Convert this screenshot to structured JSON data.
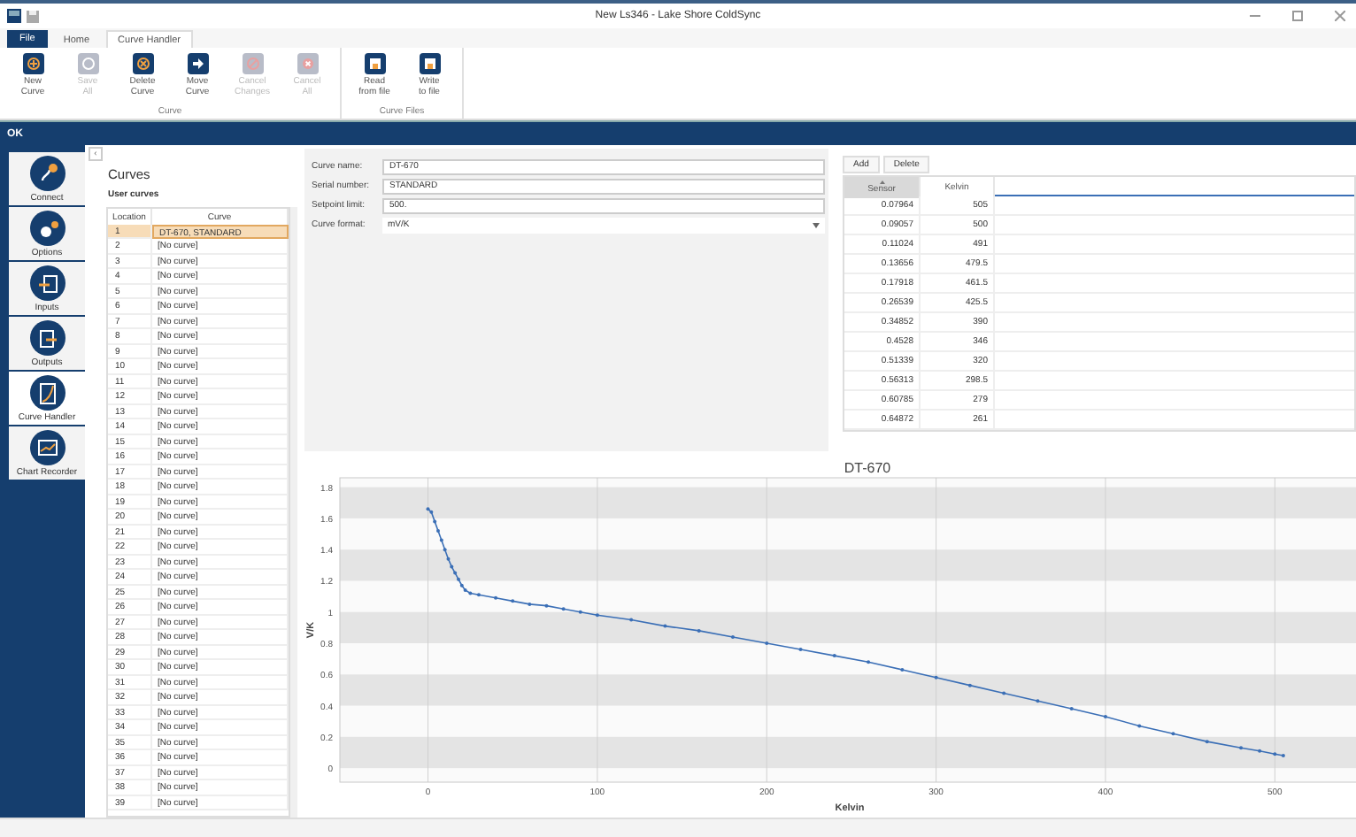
{
  "window": {
    "title": "New Ls346 - Lake Shore ColdSync"
  },
  "file_menu": {
    "label": "File"
  },
  "tabs": [
    {
      "label": "Home",
      "selected": false
    },
    {
      "label": "Curve Handler",
      "selected": true
    }
  ],
  "ribbon": {
    "groups": [
      {
        "label": "Curve",
        "buttons": [
          {
            "lines": [
              "New",
              "Curve"
            ],
            "disabled": false
          },
          {
            "lines": [
              "Save",
              "All"
            ],
            "disabled": true
          },
          {
            "lines": [
              "Delete",
              "Curve"
            ],
            "disabled": false
          },
          {
            "lines": [
              "Move",
              "Curve"
            ],
            "disabled": false
          },
          {
            "lines": [
              "Cancel",
              "Changes"
            ],
            "disabled": true
          },
          {
            "lines": [
              "Cancel",
              "All"
            ],
            "disabled": true
          }
        ]
      },
      {
        "label": "Curve Files",
        "buttons": [
          {
            "lines": [
              "Read",
              "from file"
            ],
            "disabled": false
          },
          {
            "lines": [
              "Write",
              "to file"
            ],
            "disabled": false
          }
        ]
      }
    ]
  },
  "status_strip": {
    "text": "OK"
  },
  "sidebar": {
    "items": [
      {
        "label": "Connect",
        "selected": false
      },
      {
        "label": "Options",
        "selected": false
      },
      {
        "label": "Inputs",
        "selected": false
      },
      {
        "label": "Outputs",
        "selected": false
      },
      {
        "label": "Curve Handler",
        "selected": true
      },
      {
        "label": "Chart Recorder",
        "selected": false
      }
    ]
  },
  "curves_panel": {
    "collapse": "‹",
    "title": "Curves",
    "subtitle": "User curves",
    "columns": [
      "Location",
      "Curve"
    ],
    "rows": [
      {
        "location": "1",
        "curve": "DT-670, STANDARD",
        "selected": true
      },
      {
        "location": "2",
        "curve": "[No curve]",
        "selected": false
      },
      {
        "location": "3",
        "curve": "[No curve]",
        "selected": false
      },
      {
        "location": "4",
        "curve": "[No curve]",
        "selected": false
      },
      {
        "location": "5",
        "curve": "[No curve]",
        "selected": false
      },
      {
        "location": "6",
        "curve": "[No curve]",
        "selected": false
      },
      {
        "location": "7",
        "curve": "[No curve]",
        "selected": false
      },
      {
        "location": "8",
        "curve": "[No curve]",
        "selected": false
      },
      {
        "location": "9",
        "curve": "[No curve]",
        "selected": false
      },
      {
        "location": "10",
        "curve": "[No curve]",
        "selected": false
      },
      {
        "location": "11",
        "curve": "[No curve]",
        "selected": false
      },
      {
        "location": "12",
        "curve": "[No curve]",
        "selected": false
      },
      {
        "location": "13",
        "curve": "[No curve]",
        "selected": false
      },
      {
        "location": "14",
        "curve": "[No curve]",
        "selected": false
      },
      {
        "location": "15",
        "curve": "[No curve]",
        "selected": false
      },
      {
        "location": "16",
        "curve": "[No curve]",
        "selected": false
      },
      {
        "location": "17",
        "curve": "[No curve]",
        "selected": false
      },
      {
        "location": "18",
        "curve": "[No curve]",
        "selected": false
      },
      {
        "location": "19",
        "curve": "[No curve]",
        "selected": false
      },
      {
        "location": "20",
        "curve": "[No curve]",
        "selected": false
      },
      {
        "location": "21",
        "curve": "[No curve]",
        "selected": false
      },
      {
        "location": "22",
        "curve": "[No curve]",
        "selected": false
      },
      {
        "location": "23",
        "curve": "[No curve]",
        "selected": false
      },
      {
        "location": "24",
        "curve": "[No curve]",
        "selected": false
      },
      {
        "location": "25",
        "curve": "[No curve]",
        "selected": false
      },
      {
        "location": "26",
        "curve": "[No curve]",
        "selected": false
      },
      {
        "location": "27",
        "curve": "[No curve]",
        "selected": false
      },
      {
        "location": "28",
        "curve": "[No curve]",
        "selected": false
      },
      {
        "location": "29",
        "curve": "[No curve]",
        "selected": false
      },
      {
        "location": "30",
        "curve": "[No curve]",
        "selected": false
      },
      {
        "location": "31",
        "curve": "[No curve]",
        "selected": false
      },
      {
        "location": "32",
        "curve": "[No curve]",
        "selected": false
      },
      {
        "location": "33",
        "curve": "[No curve]",
        "selected": false
      },
      {
        "location": "34",
        "curve": "[No curve]",
        "selected": false
      },
      {
        "location": "35",
        "curve": "[No curve]",
        "selected": false
      },
      {
        "location": "36",
        "curve": "[No curve]",
        "selected": false
      },
      {
        "location": "37",
        "curve": "[No curve]",
        "selected": false
      },
      {
        "location": "38",
        "curve": "[No curve]",
        "selected": false
      },
      {
        "location": "39",
        "curve": "[No curve]",
        "selected": false
      }
    ]
  },
  "form": {
    "fields": [
      {
        "label": "Curve name:",
        "value": "DT-670",
        "kind": "text"
      },
      {
        "label": "Serial number:",
        "value": "STANDARD",
        "kind": "text"
      },
      {
        "label": "Setpoint limit:",
        "value": "500.",
        "kind": "text"
      },
      {
        "label": "Curve format:",
        "value": "mV/K",
        "kind": "select"
      }
    ]
  },
  "points_table": {
    "buttons": [
      "Add",
      "Delete"
    ],
    "columns": [
      {
        "label": "Sensor",
        "sorted": true
      },
      {
        "label": "Kelvin",
        "sorted": false
      }
    ],
    "rows": [
      [
        "0.07964",
        "505"
      ],
      [
        "0.09057",
        "500"
      ],
      [
        "0.11024",
        "491"
      ],
      [
        "0.13656",
        "479.5"
      ],
      [
        "0.17918",
        "461.5"
      ],
      [
        "0.26539",
        "425.5"
      ],
      [
        "0.34852",
        "390"
      ],
      [
        "0.4528",
        "346"
      ],
      [
        "0.51339",
        "320"
      ],
      [
        "0.56313",
        "298.5"
      ],
      [
        "0.60785",
        "279"
      ],
      [
        "0.64872",
        "261"
      ]
    ]
  },
  "chart": {
    "chart_data": {
      "type": "line",
      "title": "DT-670",
      "xlabel": "Kelvin",
      "ylabel": "V/K",
      "x": [
        0,
        2,
        4,
        6,
        8,
        10,
        12,
        14,
        16,
        18,
        20,
        22,
        25,
        30,
        40,
        50,
        60,
        70,
        80,
        90,
        100,
        120,
        140,
        160,
        180,
        200,
        220,
        240,
        260,
        280,
        300,
        320,
        340,
        360,
        380,
        400,
        420,
        440,
        460,
        480,
        491,
        500,
        505
      ],
      "series": [
        {
          "color": "#3b6fb6",
          "values": [
            1.66,
            1.64,
            1.58,
            1.52,
            1.46,
            1.4,
            1.34,
            1.29,
            1.25,
            1.21,
            1.17,
            1.14,
            1.12,
            1.11,
            1.09,
            1.07,
            1.05,
            1.04,
            1.02,
            1.0,
            0.98,
            0.95,
            0.91,
            0.88,
            0.84,
            0.8,
            0.76,
            0.72,
            0.68,
            0.63,
            0.58,
            0.53,
            0.48,
            0.43,
            0.38,
            0.33,
            0.27,
            0.22,
            0.17,
            0.13,
            0.11,
            0.09,
            0.08
          ]
        }
      ],
      "grid": true,
      "xlim": [
        -52,
        550
      ],
      "ylim": [
        -0.09,
        1.86
      ],
      "xticks": [
        0,
        100,
        200,
        300,
        400,
        500
      ],
      "yticks": [
        0,
        0.2,
        0.4,
        0.6,
        0.8,
        1,
        1.2,
        1.4,
        1.6,
        1.8
      ]
    }
  }
}
